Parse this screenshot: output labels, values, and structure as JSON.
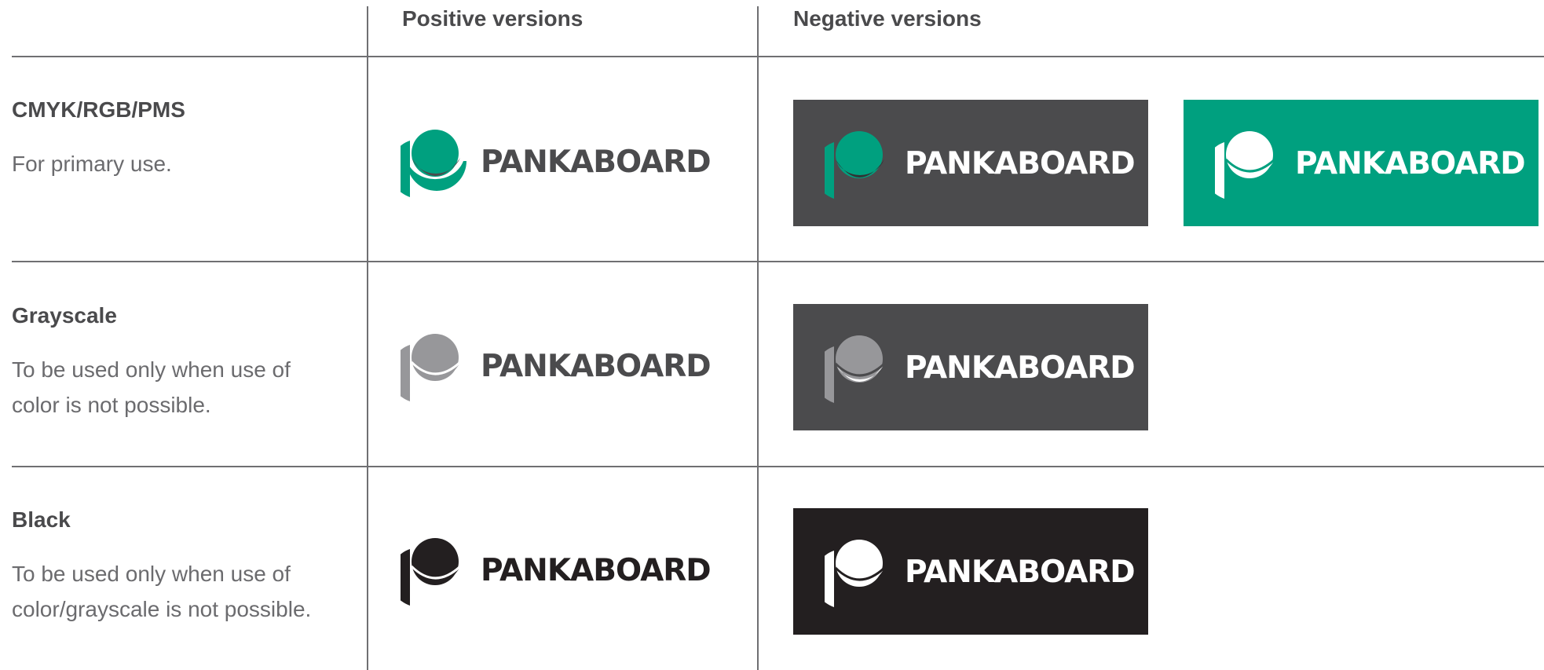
{
  "headers": {
    "positive": "Positive versions",
    "negative": "Negative versions"
  },
  "brand": {
    "wordmark": "PANKABOARD"
  },
  "colors": {
    "brand_green": "#00a07f",
    "dark_gray": "#4b4b4d",
    "light_gray": "#97979a",
    "black": "#231f20",
    "white": "#ffffff"
  },
  "rows": [
    {
      "title": "CMYK/RGB/PMS",
      "description": "For primary use."
    },
    {
      "title": "Grayscale",
      "description": "To be used only when use of color is not possible."
    },
    {
      "title": "Black",
      "description": "To be used only when use of color/grayscale is not possible."
    }
  ]
}
